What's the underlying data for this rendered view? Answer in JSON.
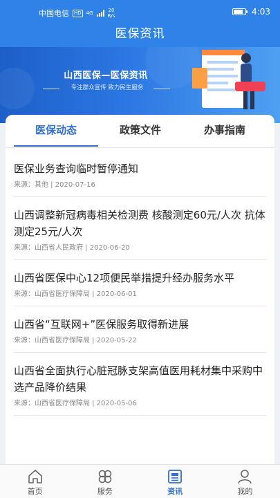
{
  "status_bar": {
    "carrier": "中国电信",
    "hd": "HD",
    "net_type": "4G",
    "speed_value": "20",
    "speed_unit": "B/s",
    "time": "4:03"
  },
  "header": {
    "title": "医保资讯"
  },
  "banner": {
    "title": "山西医保—医保资讯",
    "subtitle": "专注群众宣传 致力民生服务"
  },
  "tabs": [
    {
      "label": "医保动态",
      "active": true
    },
    {
      "label": "政策文件",
      "active": false
    },
    {
      "label": "办事指南",
      "active": false
    }
  ],
  "news": [
    {
      "title": "医保业务查询临时暂停通知",
      "source": "来源：其他 | 2020-07-16"
    },
    {
      "title": "山西调整新冠病毒相关检测费 核酸测定60元/人次 抗体测定25元/人次",
      "source": "来源：山西省人民政府 | 2020-06-20"
    },
    {
      "title": "山西省医保中心12项便民举措提升经办服务水平",
      "source": "来源：山西省医疗保障局 | 2020-06-01"
    },
    {
      "title": "山西省“互联网+”医保服务取得新进展",
      "source": "来源：山西省医疗保障局 | 2020-05-22"
    },
    {
      "title": "山西省全面执行心脏冠脉支架高值医用耗材集中采购中选产品降价结果",
      "source": "来源：山西省医疗保障局 | 2020-05-06"
    }
  ],
  "bottom_nav": [
    {
      "label": "首页",
      "icon": "home-icon"
    },
    {
      "label": "服务",
      "icon": "services-icon"
    },
    {
      "label": "资讯",
      "icon": "news-icon",
      "active": true
    },
    {
      "label": "我的",
      "icon": "profile-icon"
    }
  ],
  "colors": {
    "primary": "#2f82e8",
    "accent": "#2f6fd6"
  }
}
